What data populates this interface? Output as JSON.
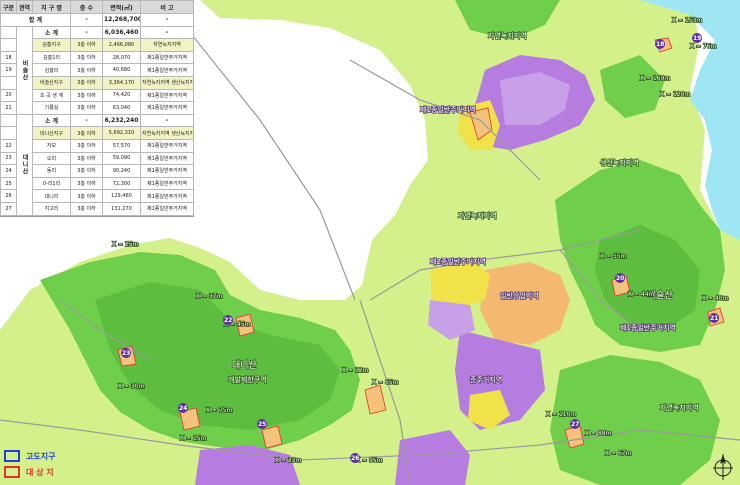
{
  "table": {
    "headers": [
      "구분",
      "권역",
      "지 구 명",
      "층 수",
      "면적(㎡)",
      "비 고"
    ],
    "total": {
      "label": "합 계",
      "floors": "-",
      "area": "12,268,700",
      "note": "-"
    },
    "groups": [
      {
        "name": "비\n슬\n산",
        "subtotal": {
          "label": "소 계",
          "floors": "-",
          "area": "6,036,460",
          "note": "-"
        },
        "rows": [
          {
            "no": "",
            "name": "김흥지구",
            "floors": "3층 이하",
            "area": "2,466,080",
            "note": "자연녹지지역"
          },
          {
            "no": "18",
            "name": "김흥1리",
            "floors": "3층 이하",
            "area": "28,070",
            "note": "제1종일반주거지역"
          },
          {
            "no": "19",
            "name": "김흥리",
            "floors": "3층 이하",
            "area": "40,680",
            "note": "제1종일반주거지역"
          },
          {
            "no": "",
            "name": "비슬산지구",
            "floors": "3층 이하",
            "area": "3,364,170",
            "note": "자연녹지지역 생산녹지지역"
          },
          {
            "no": "20",
            "name": "초 곡 생 계",
            "floors": "3층 이하",
            "area": "74,420",
            "note": "제1종일반주거지역"
          },
          {
            "no": "21",
            "name": "기룡실",
            "floors": "3층 이하",
            "area": "63,040",
            "note": "제1종일반주거지역"
          }
        ]
      },
      {
        "name": "대\n니\n산",
        "subtotal": {
          "label": "소 계",
          "floors": "-",
          "area": "6,232,240",
          "note": "-"
        },
        "rows": [
          {
            "no": "",
            "name": "대니산지구",
            "floors": "3층 이하",
            "area": "5,692,310",
            "note": "자연녹지지역 생산녹지지역"
          },
          {
            "no": "22",
            "name": "자모",
            "floors": "3층 이하",
            "area": "57,570",
            "note": "제1종일반주거지역"
          },
          {
            "no": "23",
            "name": "오리",
            "floors": "3층 이하",
            "area": "59,090",
            "note": "제1종일반주거지역"
          },
          {
            "no": "24",
            "name": "동리",
            "floors": "3층 이하",
            "area": "90,240",
            "note": "제1종일반주거지역"
          },
          {
            "no": "25",
            "name": "0-리1리",
            "floors": "3층 이하",
            "area": "72,300",
            "note": "제1종일반주거지역"
          },
          {
            "no": "26",
            "name": "대니리",
            "floors": "3층 이하",
            "area": "129,460",
            "note": "제1종일반주거지역"
          },
          {
            "no": "27",
            "name": "지고리",
            "floors": "3층 이하",
            "area": "131,270",
            "note": "제1종일반주거지역"
          }
        ]
      }
    ]
  },
  "legend": {
    "items": [
      {
        "label": "고도지구",
        "color": "#1f3fd6"
      },
      {
        "label": "대 상 지",
        "color": "#e53030"
      }
    ]
  },
  "map": {
    "colors": {
      "base": "#d3f08a",
      "forest": "#6fce4a",
      "forest_dark": "#4fa83a",
      "residential": "#b77ce0",
      "commercial": "#f2e24a",
      "urban": "#f4b870",
      "water": "#9fe6f4",
      "road": "#9a9a9a",
      "site": "#e53030"
    },
    "labels": [
      "비슬산",
      "대니산",
      "자연녹지지역",
      "생산녹지지역",
      "제1종일반주거지역",
      "제2종일반주거지역",
      "일반상업지역",
      "준주거지역",
      "개발제한구역"
    ],
    "elevations": [
      "X = 153m",
      "X = 76m",
      "X = 169m",
      "X = 120m",
      "X = 25m",
      "X = 37m",
      "X = 45m",
      "X = 30m",
      "X = 12m",
      "X = 65m",
      "X = 55m",
      "X = 44m",
      "X = 40m",
      "X = 75m",
      "X = 15m",
      "X = 23m",
      "X = 88m",
      "X = 67m",
      "X = 110m",
      "X = 95m"
    ],
    "markers": [
      "18",
      "19",
      "20",
      "21",
      "22",
      "23",
      "24",
      "25",
      "26",
      "27"
    ]
  }
}
